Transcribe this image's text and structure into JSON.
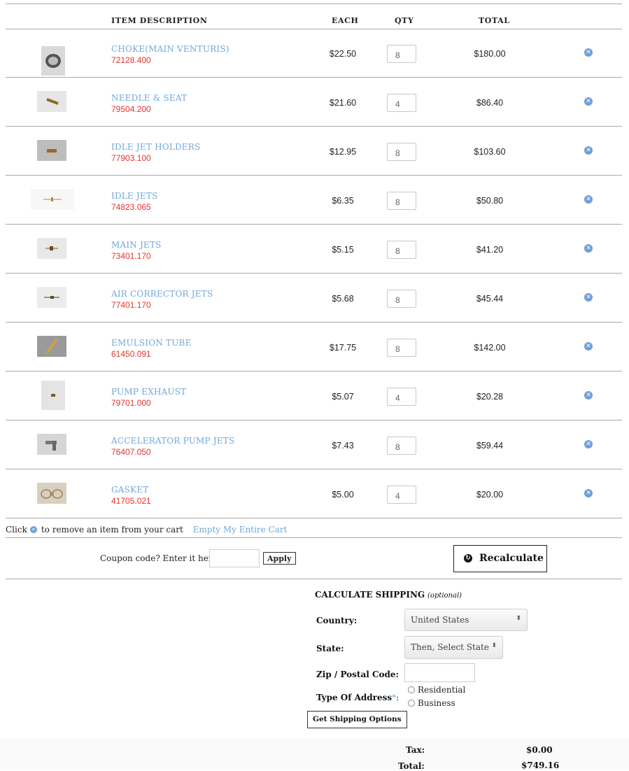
{
  "headers": {
    "item_description": "ITEM DESCRIPTION",
    "each": "EACH",
    "qty": "QTY",
    "total": "TOTAL"
  },
  "items": [
    {
      "name": "CHOKE(MAIN VENTURIS)",
      "sku": "72128.400",
      "each": "$22.50",
      "qty": "8",
      "total": "$180.00",
      "thumb": "ring"
    },
    {
      "name": "NEEDLE & SEAT",
      "sku": "79504.200",
      "each": "$21.60",
      "qty": "4",
      "total": "$86.40",
      "thumb": "needle"
    },
    {
      "name": "IDLE JET HOLDERS",
      "sku": "77903.100",
      "each": "$12.95",
      "qty": "8",
      "total": "$103.60",
      "thumb": "holder"
    },
    {
      "name": "IDLE JETS",
      "sku": "74823.065",
      "each": "$6.35",
      "qty": "8",
      "total": "$50.80",
      "thumb": "idlejet"
    },
    {
      "name": "MAIN JETS",
      "sku": "73401.170",
      "each": "$5.15",
      "qty": "8",
      "total": "$41.20",
      "thumb": "mainjet"
    },
    {
      "name": "AIR CORRECTOR JETS",
      "sku": "77401.170",
      "each": "$5.68",
      "qty": "8",
      "total": "$45.44",
      "thumb": "airjet"
    },
    {
      "name": "EMULSION TUBE",
      "sku": "61450.091",
      "each": "$17.75",
      "qty": "8",
      "total": "$142.00",
      "thumb": "tube"
    },
    {
      "name": "PUMP EXHAUST",
      "sku": "79701.000",
      "each": "$5.07",
      "qty": "4",
      "total": "$20.28",
      "thumb": "pump"
    },
    {
      "name": "ACCELERATOR PUMP JETS",
      "sku": "76407.050",
      "each": "$7.43",
      "qty": "8",
      "total": "$59.44",
      "thumb": "accel"
    },
    {
      "name": "GASKET",
      "sku": "41705.021",
      "each": "$5.00",
      "qty": "4",
      "total": "$20.00",
      "thumb": "gasket"
    }
  ],
  "remove_hint": {
    "prefix": "Click",
    "suffix": "to remove an item from your cart",
    "empty_cart": "Empty My Entire Cart"
  },
  "coupon": {
    "label": "Coupon code? Enter it here:",
    "button": "Apply",
    "value": ""
  },
  "recalculate": {
    "label": "Recalculate"
  },
  "shipping": {
    "title": "CALCULATE SHIPPING",
    "optional": "(optional)",
    "country_label": "Country:",
    "country_value": "United States",
    "state_label": "State:",
    "state_value": "Then, Select State",
    "zip_label": "Zip / Postal Code:",
    "zip_value": "",
    "address_type_label": "Type Of Address",
    "required_mark": "*",
    "colon": ":",
    "residential": "Residential",
    "business": "Business",
    "button": "Get Shipping Options"
  },
  "summary": {
    "tax_label": "Tax:",
    "tax_value": "$0.00",
    "total_label": "Total:",
    "total_value": "$749.16"
  },
  "colors": {
    "link": "#6fa8dc",
    "sku": "#e8332e",
    "remove_icon": "#6f9fd8",
    "divider": "#aaaaaa"
  }
}
